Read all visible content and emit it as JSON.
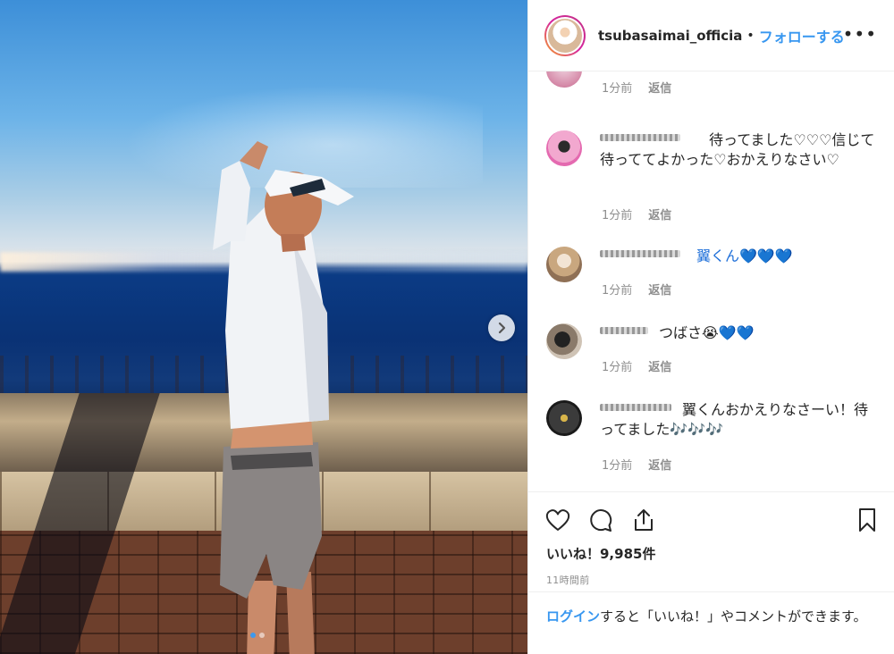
{
  "header": {
    "username": "tsubasaimai_officia",
    "separator": "•",
    "follow_label": "フォローする",
    "more_label": "•••"
  },
  "comments": [
    {
      "text": "",
      "time": "1分前",
      "reply": "返信"
    },
    {
      "text": "待ってました♡♡♡信じて待っててよかった♡おかえりなさい♡",
      "time": "1分前",
      "reply": "返信"
    },
    {
      "text": "翼くん💙💙💙",
      "time": "1分前",
      "reply": "返信"
    },
    {
      "text": "つばさ😭💙💙",
      "time": "1分前",
      "reply": "返信"
    },
    {
      "text": "翼くんおかえりなさーい！待ってました🎶🎶🎶",
      "time": "1分前",
      "reply": "返信"
    }
  ],
  "likes": "いいね！9,985件",
  "time_ago": "11時間前",
  "login": {
    "link": "ログイン",
    "rest": "すると「いいね！」やコメントができます。"
  },
  "colors": {
    "link_blue": "#3897f0",
    "text": "#262626",
    "meta": "#8e8e8e",
    "story_ring": "#d6249f"
  },
  "icons": [
    "heart-icon",
    "comment-icon",
    "share-icon",
    "bookmark-icon",
    "chevron-right-icon",
    "more-icon"
  ],
  "carousel": {
    "total_slides": 2,
    "active_slide": 1
  }
}
